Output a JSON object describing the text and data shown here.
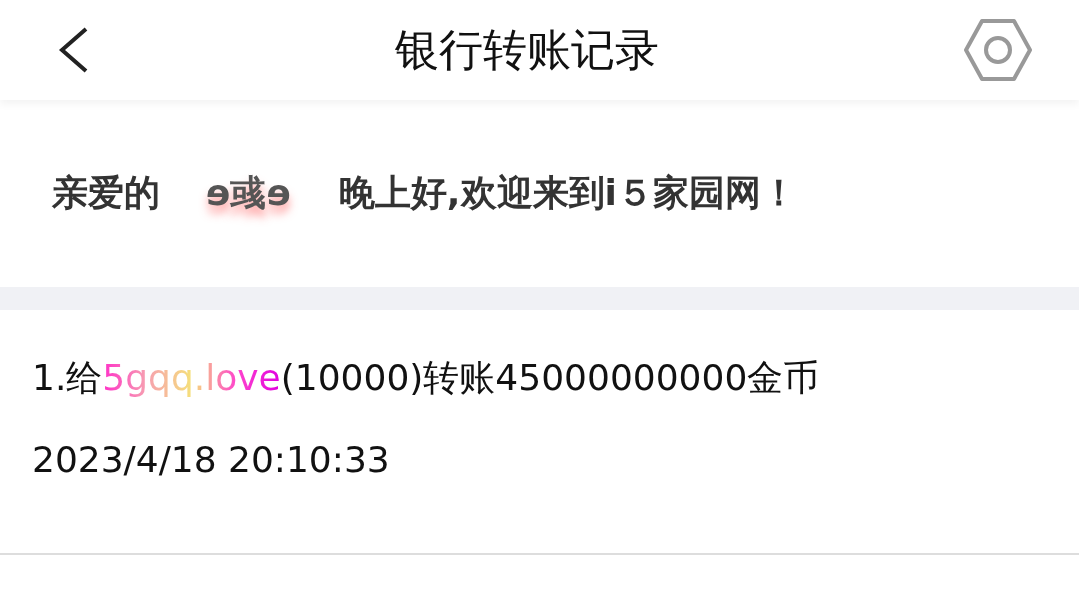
{
  "header": {
    "title": "银行转账记录"
  },
  "greeting": {
    "prefix": "亲爱的",
    "username": "ɘ彧ɘ",
    "message": "晚上好,欢迎来到i５家园网！"
  },
  "records": [
    {
      "index": "1.给",
      "recipient": "5gqq.love",
      "detail": "(10000)转账45000000000金币",
      "time": "2023/4/18 20:10:33"
    }
  ]
}
